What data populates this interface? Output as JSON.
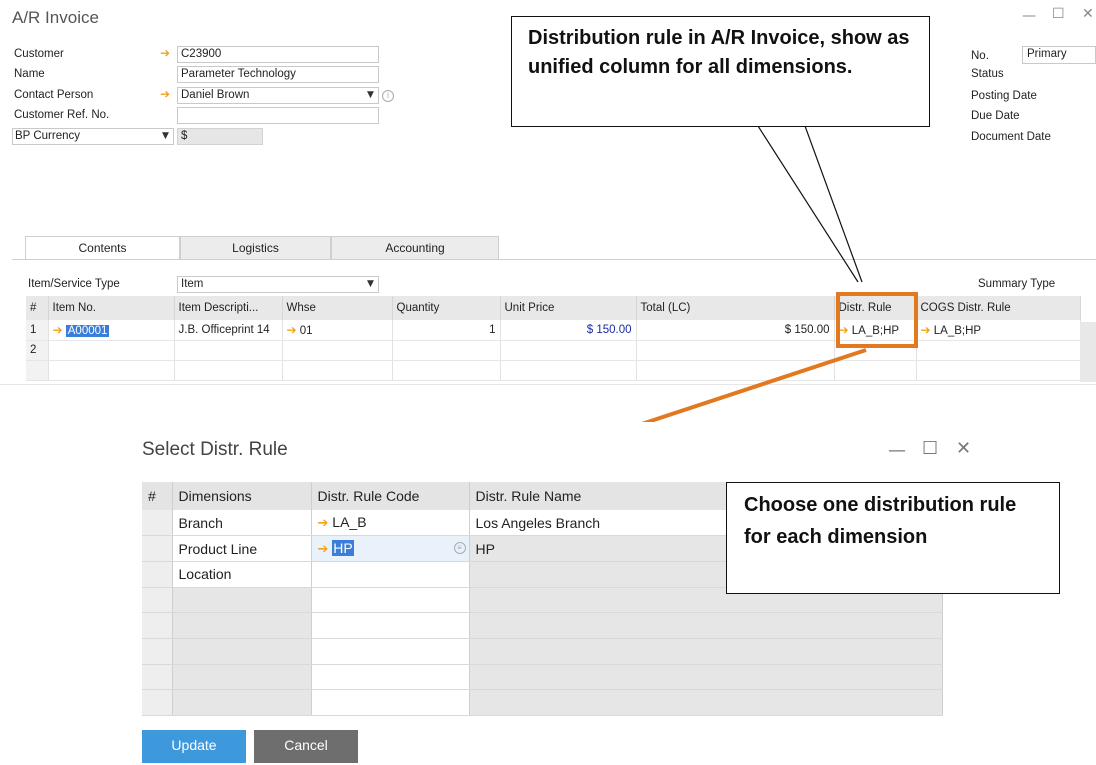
{
  "invoice": {
    "title": "A/R Invoice",
    "header": {
      "customer_label": "Customer",
      "customer_value": "C23900",
      "name_label": "Name",
      "name_value": "Parameter Technology",
      "contact_label": "Contact Person",
      "contact_value": "Daniel Brown",
      "ref_label": "Customer Ref. No.",
      "ref_value": "",
      "currency_select": "BP Currency",
      "currency_value": "$"
    },
    "right": {
      "no_label": "No.",
      "no_value": "Primary",
      "status_label": "Status",
      "posting_label": "Posting Date",
      "due_label": "Due Date",
      "document_label": "Document Date"
    },
    "tabs": [
      "Contents",
      "Logistics",
      "Accounting"
    ],
    "item_type_label": "Item/Service Type",
    "item_type_value": "Item",
    "summary_type_label": "Summary Type",
    "columns": [
      "#",
      "Item No.",
      "Item Descripti...",
      "Whse",
      "Quantity",
      "Unit Price",
      "Total (LC)",
      "Distr. Rule",
      "COGS Distr. Rule"
    ],
    "rows": [
      {
        "num": "1",
        "item_no": "A00001",
        "desc": "J.B. Officeprint 14",
        "whse": "01",
        "qty": "1",
        "unit_price": "$ 150.00",
        "total": "$ 150.00",
        "distr": "LA_B;HP",
        "cogs": "LA_B;HP"
      },
      {
        "num": "2",
        "item_no": "",
        "desc": "",
        "whse": "",
        "qty": "",
        "unit_price": "",
        "total": "",
        "distr": "",
        "cogs": ""
      }
    ]
  },
  "callouts": {
    "top": "Distribution rule in A/R Invoice, show as unified column for all dimensions.",
    "bottom": "Choose one distribution rule for each dimension"
  },
  "dialog": {
    "title": "Select Distr. Rule",
    "columns": [
      "#",
      "Dimensions",
      "Distr. Rule Code",
      "Distr. Rule Name"
    ],
    "rows": [
      {
        "dimension": "Branch",
        "code": "LA_B",
        "name": "Los Angeles Branch"
      },
      {
        "dimension": "Product Line",
        "code": "HP",
        "name": "HP"
      },
      {
        "dimension": "Location",
        "code": "",
        "name": ""
      }
    ],
    "update_label": "Update",
    "cancel_label": "Cancel"
  },
  "colors": {
    "accent_orange": "#e2781f",
    "link_arrow": "#f3a21b",
    "update_button": "#3d98dc",
    "cancel_button": "#6e6e6e",
    "selection": "#3a7ed8"
  }
}
